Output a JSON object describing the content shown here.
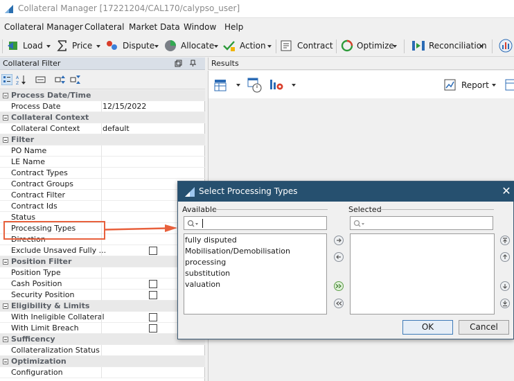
{
  "window": {
    "title": "Collateral Manager [17221204/CAL170/calypso_user]"
  },
  "menu": [
    "Collateral Manager",
    "Collateral",
    "Market Data",
    "Window",
    "Help"
  ],
  "toolbar": {
    "load": "Load",
    "price": "Price",
    "dispute": "Dispute",
    "allocate": "Allocate",
    "action": "Action",
    "contract": "Contract",
    "optimize": "Optimize",
    "reconciliation": "Reconciliation"
  },
  "left_panel": {
    "title": "Collateral Filter",
    "categories": {
      "process_date_time": "Process Date/Time",
      "collateral_context": "Collateral Context",
      "filter": "Filter",
      "position_filter": "Position Filter",
      "eligibility_limits": "Eligibility & Limits",
      "sufficency": "Sufficency",
      "optimization": "Optimization"
    },
    "props": {
      "process_date": {
        "label": "Process Date",
        "value": "12/15/2022"
      },
      "collateral_context": {
        "label": "Collateral Context",
        "value": "default"
      },
      "po_name": "PO Name",
      "le_name": "LE Name",
      "contract_types": "Contract Types",
      "contract_groups": "Contract Groups",
      "contract_filter": "Contract Filter",
      "contract_ids": "Contract Ids",
      "status": "Status",
      "processing_types": "Processing Types",
      "direction": "Direction",
      "exclude_unsaved": "Exclude Unsaved Fully ...",
      "position_type": "Position Type",
      "cash_position": "Cash Position",
      "security_position": "Security Position",
      "with_ineligible_collateral": "With Ineligible Collateral",
      "with_limit_breach": "With Limit Breach",
      "collateralization_status": "Collateralization Status",
      "configuration": "Configuration"
    }
  },
  "right_panel": {
    "tab": "Results",
    "report": "Report"
  },
  "dialog": {
    "title": "Select Processing Types",
    "available_label": "Available",
    "selected_label": "Selected",
    "available_items": [
      "fully disputed",
      "Mobilisation/Demobilisation",
      "processing",
      "substitution",
      "valuation"
    ],
    "ok": "OK",
    "cancel": "Cancel"
  },
  "colors": {
    "dialog_title_bg": "#26506f",
    "highlight": "#e8603c",
    "panel_header": "#d9dfe7"
  }
}
